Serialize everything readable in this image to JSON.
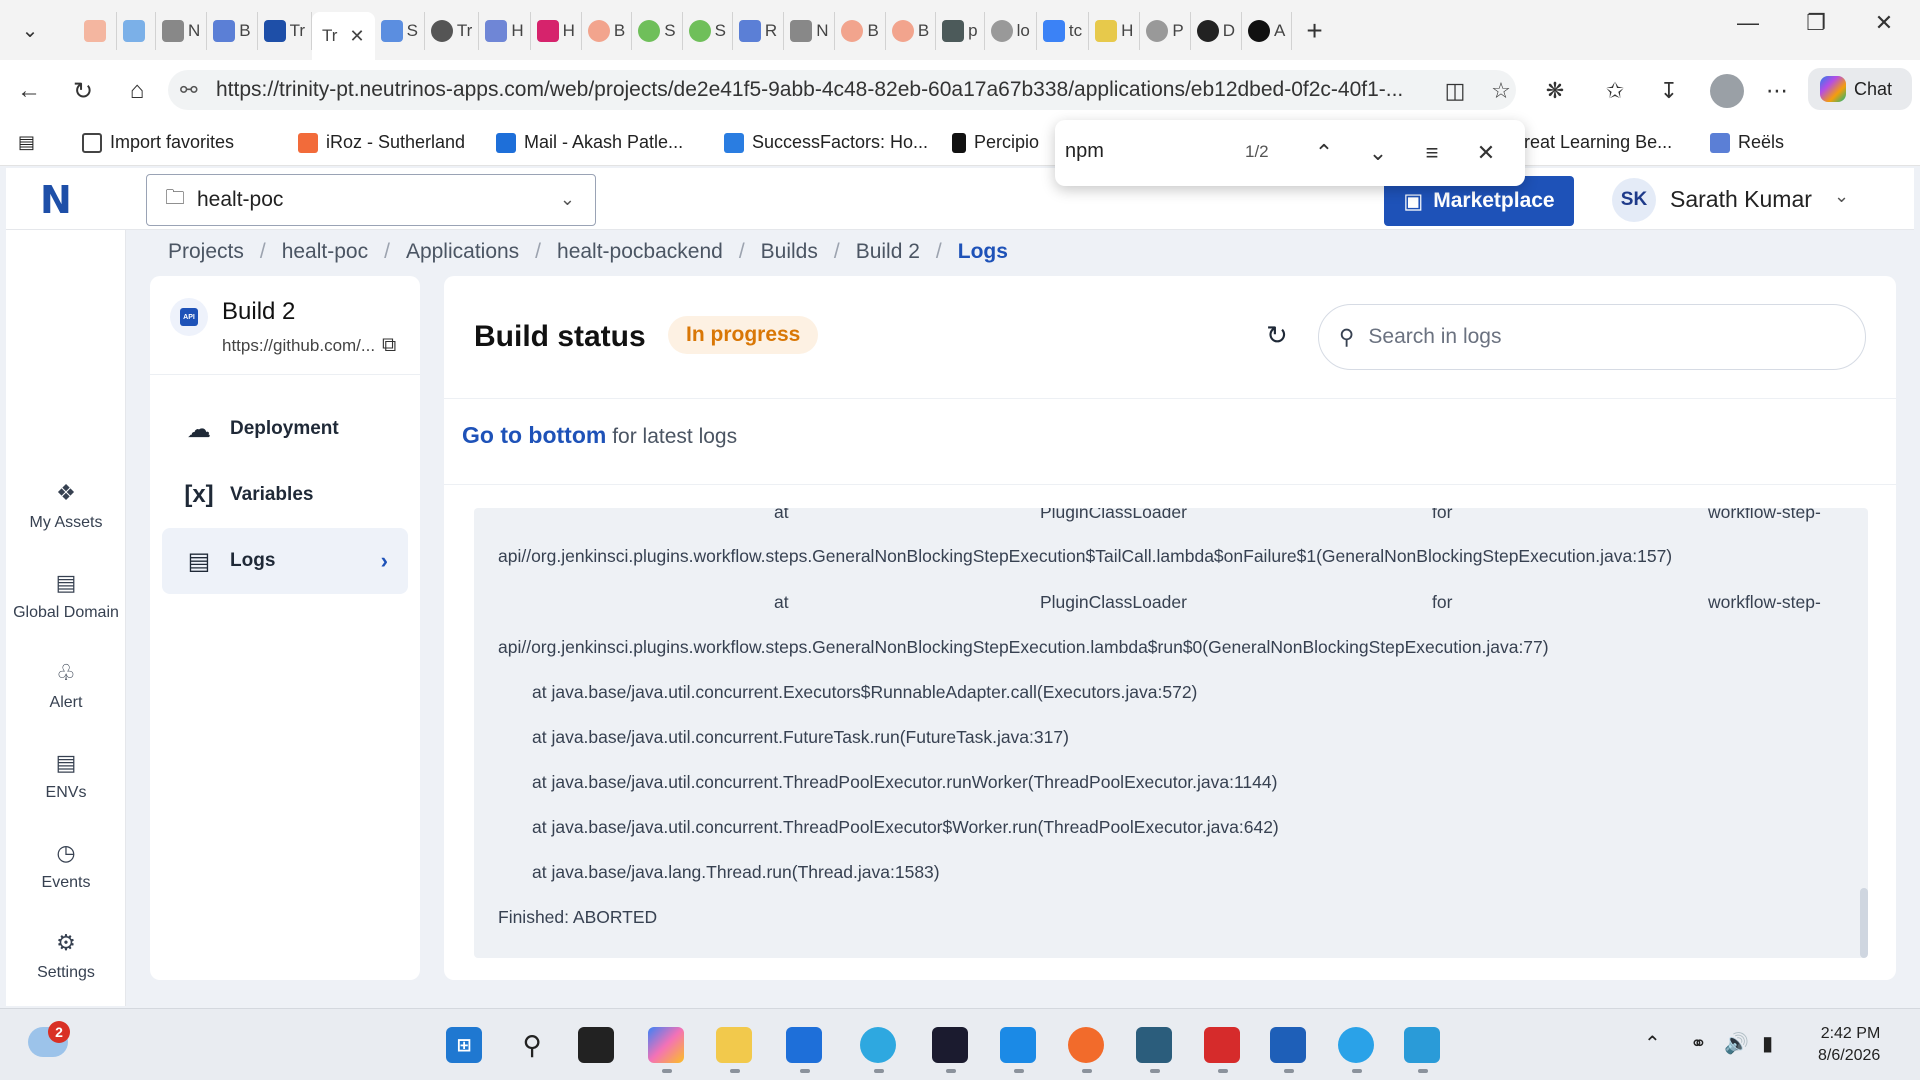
{
  "browser": {
    "active_tab_title": "Tr",
    "tabs": [
      "",
      "",
      "N",
      "B",
      "Tr",
      "Tr",
      "S",
      "Tr",
      "H",
      "H",
      "B",
      "S",
      "S",
      "R",
      "N",
      "B",
      "B",
      "p",
      "lo",
      "tc",
      "H",
      "P",
      "D",
      "A"
    ],
    "url": "https://trinity-pt.neutrinos-apps.com/web/projects/de2e41f5-9abb-4c48-82eb-60a17a67b338/applications/eb12dbed-0f2c-40f1-...",
    "chat_label": "Chat",
    "bookmarks": [
      "Import favorites",
      "iRoz - Sutherland",
      "Mail - Akash Patle...",
      "SuccessFactors: Ho...",
      "Percipio",
      "reat Learning Be...",
      "Reëls"
    ],
    "find": {
      "query": "npm",
      "count": "1/2"
    }
  },
  "app": {
    "project_select": "healt-poc",
    "marketplace_label": "Marketplace",
    "user_initials": "SK",
    "user_name": "Sarath Kumar",
    "nav": [
      {
        "label": "My Assets"
      },
      {
        "label": "Global Domain"
      },
      {
        "label": "Alert"
      },
      {
        "label": "ENVs"
      },
      {
        "label": "Events"
      },
      {
        "label": "Settings"
      }
    ],
    "breadcrumb": [
      "Projects",
      "healt-poc",
      "Applications",
      "healt-pocbackend",
      "Builds",
      "Build 2",
      "Logs"
    ],
    "build": {
      "title": "Build 2",
      "repo": "https://github.com/...",
      "api_badge": "API"
    },
    "side_links": [
      "Deployment",
      "Variables",
      "Logs"
    ],
    "main": {
      "title": "Build status",
      "status": "In progress",
      "search_placeholder": "Search in logs",
      "goto_link": "Go to bottom",
      "goto_rest": " for latest logs"
    },
    "logs": {
      "at_word": "at",
      "loader": "PluginClassLoader",
      "for_word": "for",
      "step": "workflow-step-",
      "lines": [
        "api//org.jenkinsci.plugins.workflow.steps.GeneralNonBlockingStepExecution$TailCall.lambda$onFailure$1(GeneralNonBlockingStepExecution.java:157)",
        "api//org.jenkinsci.plugins.workflow.steps.GeneralNonBlockingStepExecution.lambda$run$0(GeneralNonBlockingStepExecution.java:77)",
        "at java.base/java.util.concurrent.Executors$RunnableAdapter.call(Executors.java:572)",
        "at java.base/java.util.concurrent.FutureTask.run(FutureTask.java:317)",
        "at java.base/java.util.concurrent.ThreadPoolExecutor.runWorker(ThreadPoolExecutor.java:1144)",
        "at java.base/java.util.concurrent.ThreadPoolExecutor$Worker.run(ThreadPoolExecutor.java:642)",
        "at java.base/java.lang.Thread.run(Thread.java:1583)",
        "Finished: ABORTED"
      ]
    }
  },
  "taskbar": {
    "weather_badge": "2",
    "time": "2:42 PM",
    "date": "8/6/2026"
  }
}
